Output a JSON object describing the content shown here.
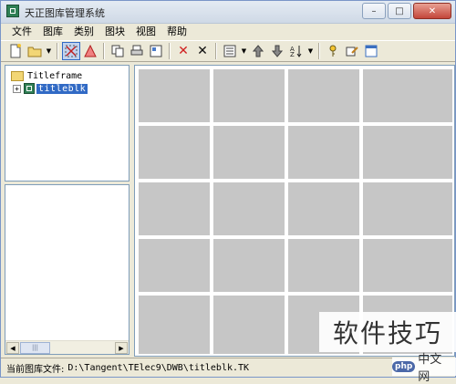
{
  "window": {
    "title": "天正图库管理系统",
    "controls": {
      "minimize": "–",
      "maximize": "□",
      "close": "✕"
    }
  },
  "menu": [
    "文件",
    "图库",
    "类别",
    "图块",
    "视图",
    "帮助"
  ],
  "toolbar_icons": [
    "new-file-icon",
    "open-file-icon",
    "dropdown-icon",
    "fit-icon",
    "triangle-icon",
    "copy-icon",
    "print-icon",
    "layout-icon",
    "delete-red-icon",
    "delete-black-icon",
    "view-list-icon",
    "dropdown-icon",
    "up-icon",
    "down-icon",
    "sort-icon",
    "dropdown-icon",
    "key-icon",
    "edit-icon",
    "window-icon"
  ],
  "tree": {
    "root_label": "Titleframe",
    "child_label": "titleblk",
    "child_expander": "+"
  },
  "grid": {
    "rows": 5,
    "cols": 4,
    "thumb_color": "#c6c6c6"
  },
  "status": {
    "label": "当前图库文件:",
    "path": "D:\\Tangent\\TElec9\\DWB\\titleblk.TK"
  },
  "watermark": {
    "text": "软件技巧",
    "site_badge": "php",
    "site_text": "中文网"
  },
  "colors": {
    "selection": "#316ac5",
    "window_bg": "#ece9d8"
  }
}
